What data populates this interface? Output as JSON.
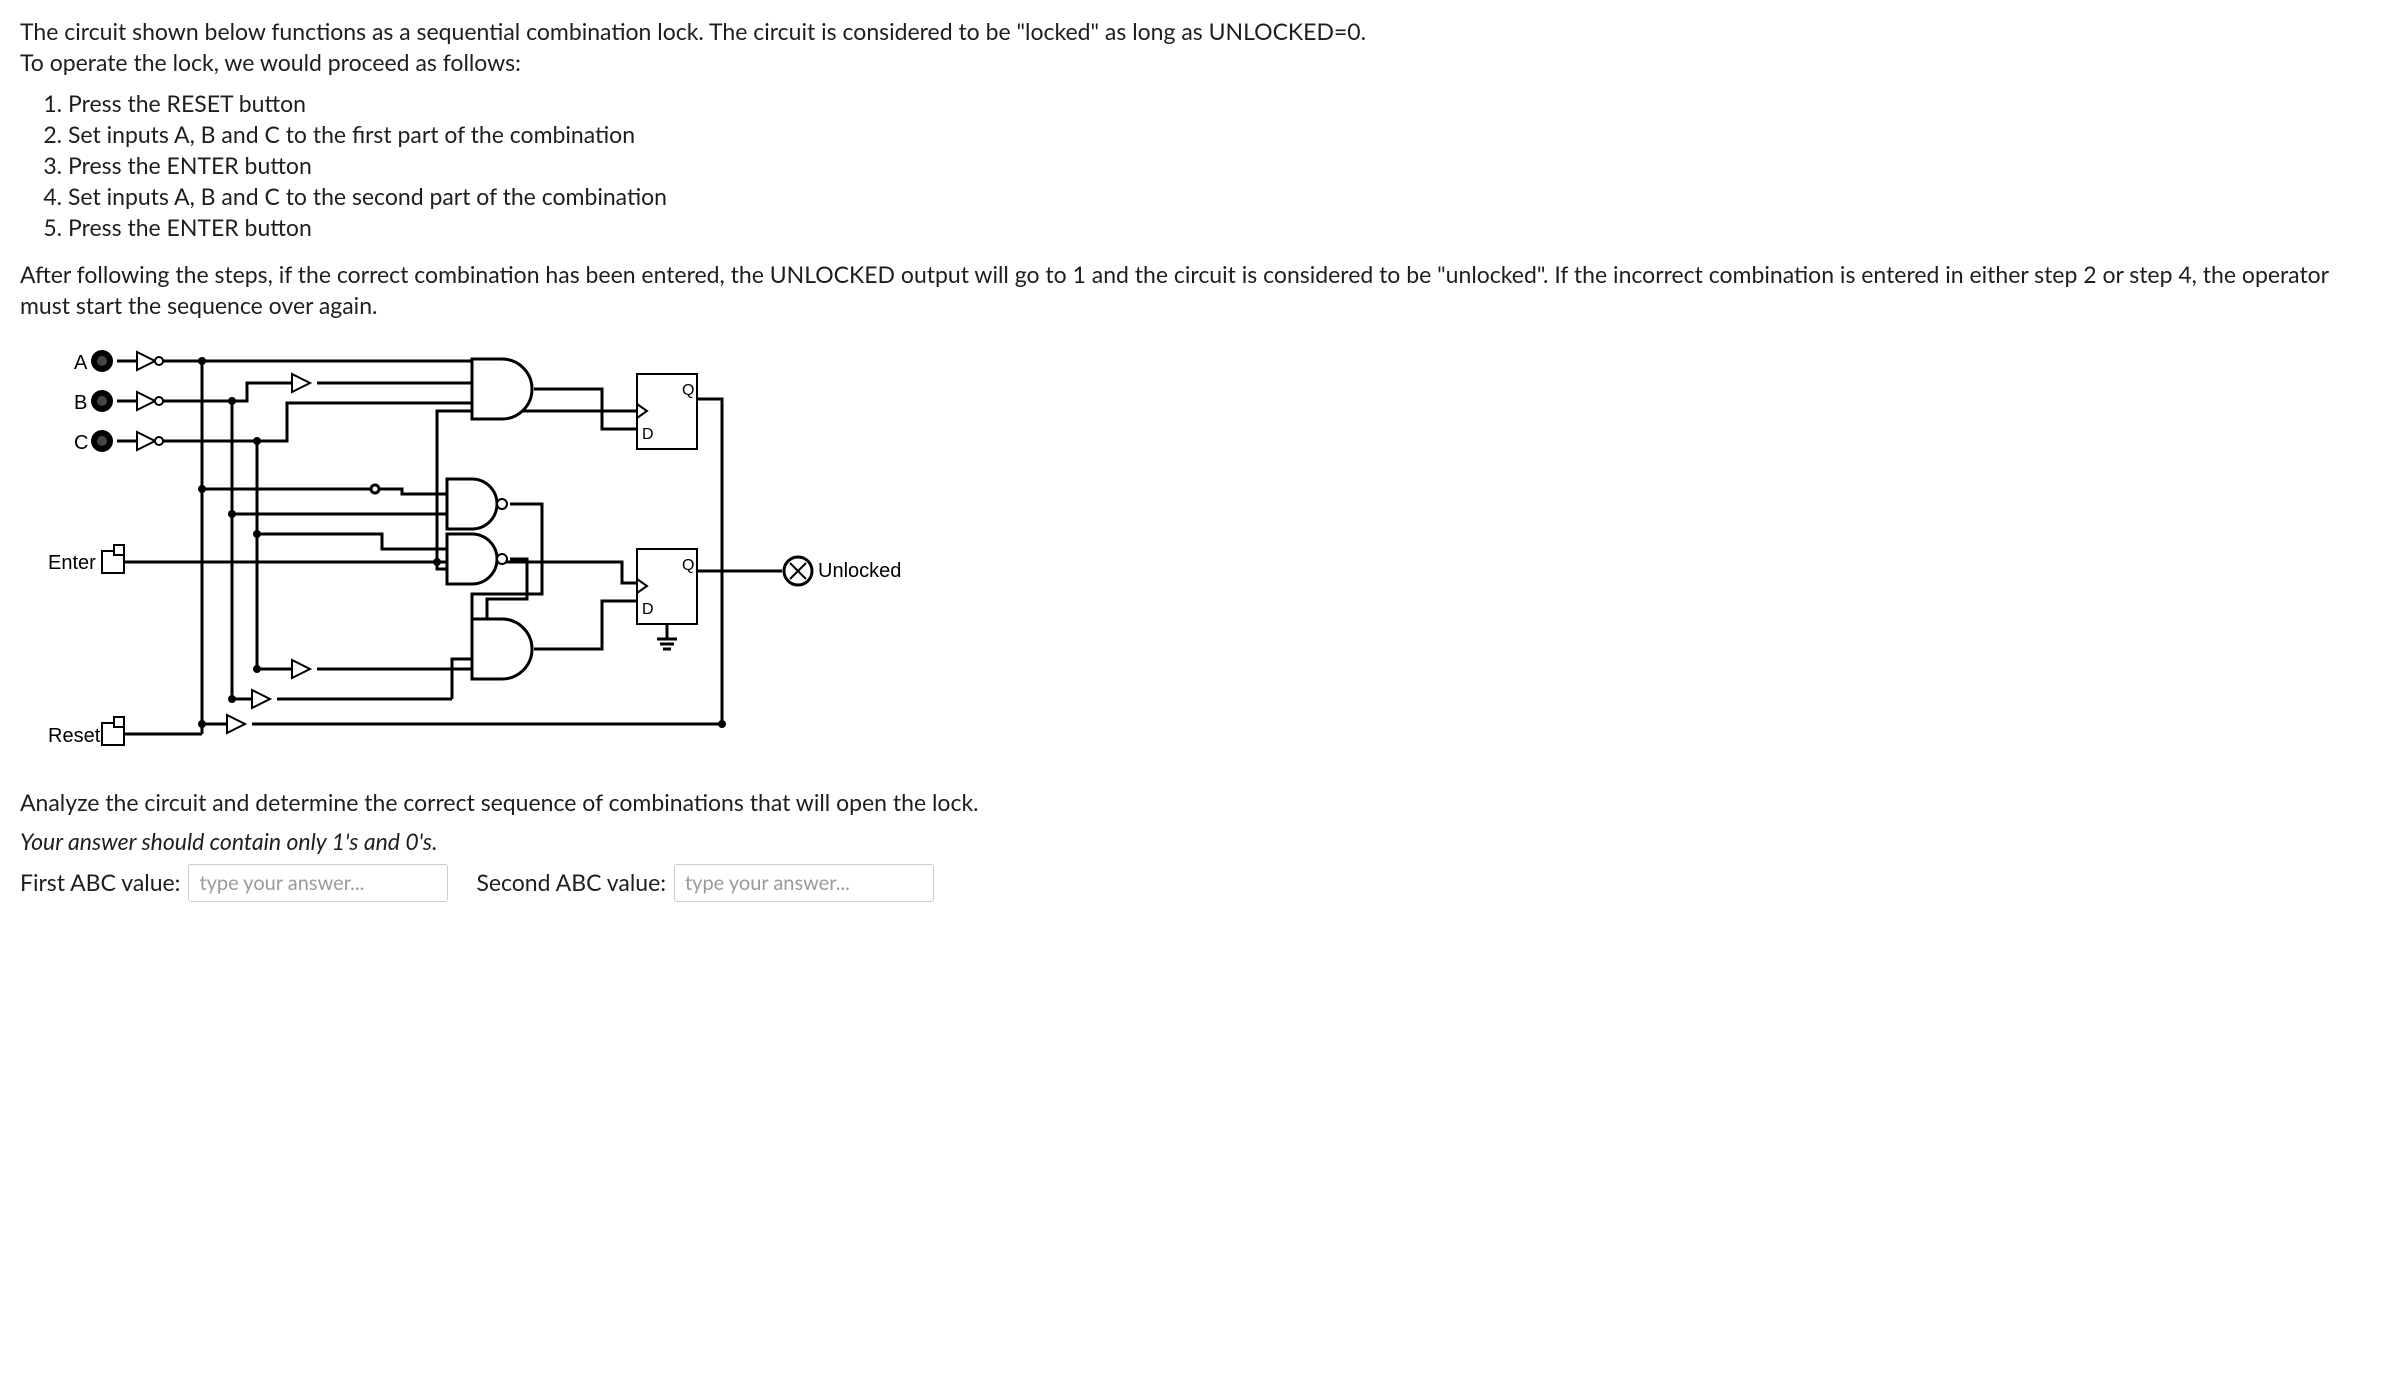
{
  "intro": {
    "line1": "The circuit shown below functions as a sequential combination lock. The circuit is considered to be \"locked\" as long as UNLOCKED=0.",
    "line2": "To operate the lock, we would proceed as follows:"
  },
  "steps": [
    "Press the RESET button",
    "Set inputs A, B and C to the first part of the combination",
    "Press the ENTER button",
    "Set inputs A, B and C to the second part of the combination",
    "Press the ENTER button"
  ],
  "after": "After following the steps, if the correct combination has been entered, the UNLOCKED output will go to 1 and the circuit is considered to be \"unlocked\". If the incorrect combination is entered in either step 2 or step 4, the operator must start the sequence over again.",
  "circuit": {
    "inputs": {
      "a": "A",
      "b": "B",
      "c": "C",
      "enter": "Enter",
      "reset": "Reset"
    },
    "flipflop": {
      "q": "Q",
      "d": "D"
    },
    "output": "Unlocked"
  },
  "prompt": "Analyze the circuit and determine the correct sequence of combinations that will open the lock.",
  "hint": "Your answer should contain only 1's and 0's.",
  "fields": {
    "first": {
      "label": "First ABC value:",
      "placeholder": "type your answer...",
      "value": ""
    },
    "second": {
      "label": "Second ABC value:",
      "placeholder": "type your answer...",
      "value": ""
    }
  }
}
